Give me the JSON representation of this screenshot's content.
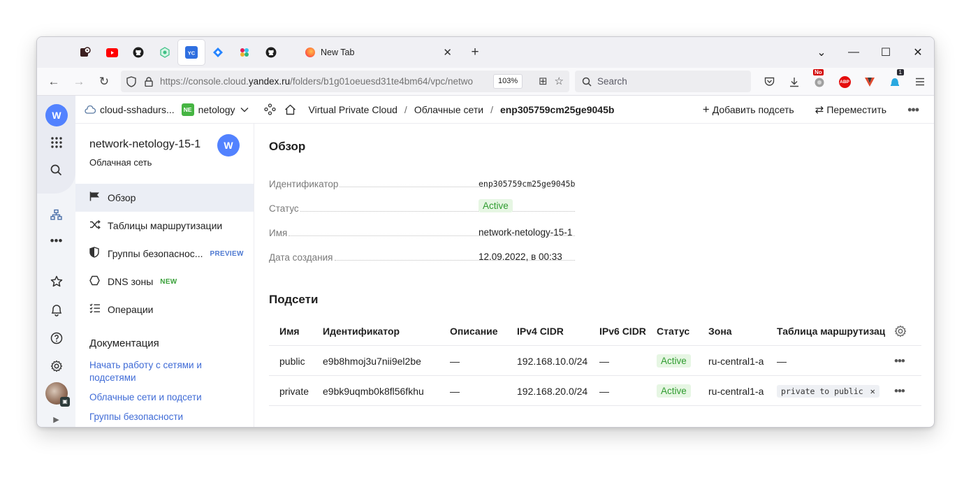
{
  "browser": {
    "pinned_tabs": [
      "media-player-icon",
      "youtube-icon",
      "github-icon",
      "extension-icon",
      "yandex-cloud-icon",
      "jira-icon",
      "slack-icon",
      "github-icon"
    ],
    "active_tab": {
      "title": "New Tab",
      "close": "✕"
    },
    "new_tab": "+",
    "url": {
      "prefix": "https://console.cloud.",
      "domain": "yandex.ru",
      "path": "/folders/b1g01oeuesd31te4bm64/vpc/netwo"
    },
    "zoom": "103%",
    "search_placeholder": "Search",
    "extension_badges": {
      "no": "No",
      "count": "1",
      "abp": "ABP"
    }
  },
  "app": {
    "logo_glyph": "W",
    "cloud_name": "cloud-sshadurs...",
    "folder_badge": "NE",
    "folder_name": "netology",
    "breadcrumbs": [
      "Virtual Private Cloud",
      "Облачные сети",
      "enp305759cm25ge9045b"
    ],
    "actions": {
      "add_subnet": "Добавить подсеть",
      "move": "Переместить"
    }
  },
  "sidebar": {
    "title": "network-netology-15-1",
    "subtitle": "Облачная сеть",
    "items": [
      {
        "label": "Обзор",
        "icon": "flag-icon",
        "tag": ""
      },
      {
        "label": "Таблицы маршрутизации",
        "icon": "shuffle-icon",
        "tag": ""
      },
      {
        "label": "Группы безопаснос...",
        "icon": "shield-icon",
        "tag": "PREVIEW"
      },
      {
        "label": "DNS зоны",
        "icon": "hexagon-icon",
        "tag": "NEW"
      },
      {
        "label": "Операции",
        "icon": "list-icon",
        "tag": ""
      }
    ],
    "doc_title": "Документация",
    "doc_links": [
      "Начать работу с сетями и подсетями",
      "Облачные сети и подсети",
      "Группы безопасности"
    ]
  },
  "overview": {
    "heading": "Обзор",
    "fields": [
      {
        "key": "Идентификатор",
        "value": "enp305759cm25ge9045b"
      },
      {
        "key": "Статус",
        "value": "Active"
      },
      {
        "key": "Имя",
        "value": "network-netology-15-1"
      },
      {
        "key": "Дата создания",
        "value": "12.09.2022, в 00:33"
      }
    ]
  },
  "subnets": {
    "heading": "Подсети",
    "columns": [
      "Имя",
      "Идентификатор",
      "Описание",
      "IPv4 CIDR",
      "IPv6 CIDR",
      "Статус",
      "Зона",
      "Таблица маршрутизаци"
    ],
    "rows": [
      {
        "name": "public",
        "id": "e9b8hmoj3u7nii9el2be",
        "description": "—",
        "ipv4": "192.168.10.0/24",
        "ipv6": "—",
        "status": "Active",
        "zone": "ru-central1-a",
        "route_table": "—"
      },
      {
        "name": "private",
        "id": "e9bk9uqmb0k8fl56fkhu",
        "description": "—",
        "ipv4": "192.168.20.0/24",
        "ipv6": "—",
        "status": "Active",
        "zone": "ru-central1-a",
        "route_table": "private to public"
      }
    ]
  },
  "colors": {
    "accent": "#5282ff",
    "link": "#3f6bd6",
    "active_bg": "#e6f6e3",
    "active_text": "#2f9c2f"
  }
}
